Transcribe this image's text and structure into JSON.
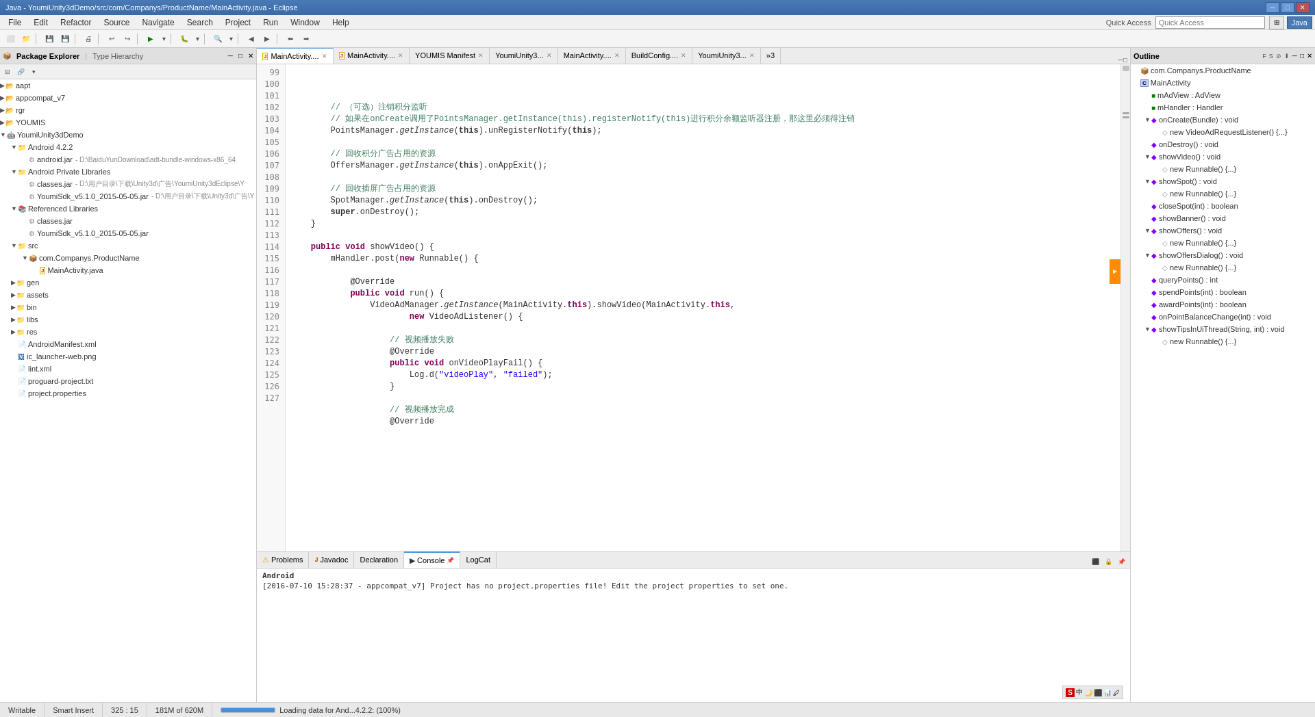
{
  "titleBar": {
    "text": "Java - YoumiUnity3dDemo/src/com/Companys/ProductName/MainActivity.java - Eclipse",
    "minBtn": "─",
    "maxBtn": "□",
    "closeBtn": "✕"
  },
  "menuBar": {
    "items": [
      "File",
      "Edit",
      "Refactor",
      "Source",
      "Navigate",
      "Search",
      "Project",
      "Run",
      "Window",
      "Help"
    ]
  },
  "quickAccess": {
    "label": "Quick Access",
    "placeholder": "Quick Access"
  },
  "packageExplorer": {
    "title": "Package Explorer",
    "typeHierarchy": "Type Hierarchy"
  },
  "editorTabs": [
    {
      "label": "MainActivity....",
      "active": true,
      "icon": "J"
    },
    {
      "label": "MainActivity....",
      "active": false,
      "icon": "J"
    },
    {
      "label": "YOUMIS Manifest",
      "active": false
    },
    {
      "label": "YoumiUnity3...",
      "active": false
    },
    {
      "label": "MainActivity....",
      "active": false
    },
    {
      "label": "BuildConfig....",
      "active": false
    },
    {
      "label": "YoumiUnity3...",
      "active": false
    },
    {
      "label": "»3",
      "active": false
    }
  ],
  "codeLines": [
    {
      "num": "99",
      "content": ""
    },
    {
      "num": "100",
      "content": "        // （可选）注销积分监听"
    },
    {
      "num": "101",
      "content": "        // 如果在onCreate调用了PointsManager.getInstance(this).registerNotify(this)进行积分余额监听器注册，那这里必须得注销"
    },
    {
      "num": "102",
      "content": "        PointsManager.getInstance(this).unRegisterNotify(this);"
    },
    {
      "num": "103",
      "content": ""
    },
    {
      "num": "104",
      "content": "        // 回收积分广告占用的资源"
    },
    {
      "num": "105",
      "content": "        OffersManager.getInstance(this).onAppExit();"
    },
    {
      "num": "106",
      "content": ""
    },
    {
      "num": "107",
      "content": "        // 回收插屏广告占用的资源"
    },
    {
      "num": "108",
      "content": "        SpotManager.getInstance(this).onDestroy();"
    },
    {
      "num": "109",
      "content": "        super.onDestroy();"
    },
    {
      "num": "110",
      "content": "    }"
    },
    {
      "num": "111",
      "content": ""
    },
    {
      "num": "112",
      "content": "    public void showVideo() {",
      "hasArrow": true
    },
    {
      "num": "113",
      "content": "        mHandler.post(new Runnable() {",
      "hasArrow": true
    },
    {
      "num": "114",
      "content": ""
    },
    {
      "num": "115",
      "content": "            @Override",
      "hasArrow": true
    },
    {
      "num": "116",
      "content": "            public void run() {",
      "hasArrow": true
    },
    {
      "num": "117",
      "content": "                VideoAdManager.getInstance(MainActivity.this).showVideo(MainActivity.this,"
    },
    {
      "num": "118",
      "content": "                        new VideoAdListener() {",
      "hasArrow": true
    },
    {
      "num": "119",
      "content": ""
    },
    {
      "num": "120",
      "content": "                    // 视频播放失败"
    },
    {
      "num": "121",
      "content": "                    @Override",
      "hasArrow": true
    },
    {
      "num": "122",
      "content": "                    public void onVideoPlayFail() {",
      "hasArrow": true
    },
    {
      "num": "123",
      "content": "                        Log.d(\"videoPlay\", \"failed\");"
    },
    {
      "num": "124",
      "content": "                    }"
    },
    {
      "num": "125",
      "content": ""
    },
    {
      "num": "126",
      "content": "                    // 视频播放完成"
    },
    {
      "num": "127",
      "content": "                    @Override"
    }
  ],
  "outline": {
    "title": "Outline",
    "items": [
      {
        "indent": 0,
        "type": "package",
        "label": "com.Companys.ProductName"
      },
      {
        "indent": 0,
        "type": "class",
        "label": "MainActivity"
      },
      {
        "indent": 1,
        "type": "field",
        "label": "mAdView : AdView"
      },
      {
        "indent": 1,
        "type": "field",
        "label": "mHandler : Handler"
      },
      {
        "indent": 1,
        "type": "method",
        "label": "onCreate(Bundle) : void",
        "expanded": true
      },
      {
        "indent": 2,
        "type": "inner",
        "label": "new VideoAdRequestListener() {...}"
      },
      {
        "indent": 1,
        "type": "method",
        "label": "onDestroy() : void"
      },
      {
        "indent": 1,
        "type": "method",
        "label": "showVideo() : void",
        "expanded": true
      },
      {
        "indent": 2,
        "type": "inner",
        "label": "new Runnable() {...}"
      },
      {
        "indent": 1,
        "type": "method",
        "label": "showSpot() : void",
        "expanded": true
      },
      {
        "indent": 2,
        "type": "inner",
        "label": "new Runnable() {...}"
      },
      {
        "indent": 1,
        "type": "method",
        "label": "closeSpot(int) : boolean"
      },
      {
        "indent": 1,
        "type": "method",
        "label": "showBanner() : void"
      },
      {
        "indent": 1,
        "type": "method",
        "label": "showOffers() : void",
        "expanded": true
      },
      {
        "indent": 2,
        "type": "inner",
        "label": "new Runnable() {...}"
      },
      {
        "indent": 1,
        "type": "method",
        "label": "showOffersDialog() : void",
        "expanded": true
      },
      {
        "indent": 2,
        "type": "inner",
        "label": "new Runnable() {...}"
      },
      {
        "indent": 1,
        "type": "method",
        "label": "queryPoints() : int"
      },
      {
        "indent": 1,
        "type": "method",
        "label": "spendPoints(int) : boolean"
      },
      {
        "indent": 1,
        "type": "method",
        "label": "awardPoints(int) : boolean"
      },
      {
        "indent": 1,
        "type": "method",
        "label": "onPointBalanceChange(int) : void"
      },
      {
        "indent": 1,
        "type": "method",
        "label": "showTipsInUiThread(String, int) : void",
        "expanded": true
      },
      {
        "indent": 2,
        "type": "inner",
        "label": "new Runnable() {...}"
      }
    ]
  },
  "treeItems": [
    {
      "indent": 0,
      "type": "proj",
      "label": "aapt",
      "expanded": false
    },
    {
      "indent": 0,
      "type": "proj",
      "label": "appcompat_v7",
      "expanded": false
    },
    {
      "indent": 0,
      "type": "proj",
      "label": "rgr",
      "expanded": false
    },
    {
      "indent": 0,
      "type": "proj",
      "label": "YOUMIS",
      "expanded": false
    },
    {
      "indent": 0,
      "type": "android-proj",
      "label": "YoumiUnity3dDemo",
      "expanded": true
    },
    {
      "indent": 1,
      "type": "folder",
      "label": "Android 4.2.2",
      "expanded": true
    },
    {
      "indent": 2,
      "type": "jar",
      "label": "android.jar",
      "detail": "D:\\BaiduYunDownload\\adt-bundle-windows-x86_64"
    },
    {
      "indent": 1,
      "type": "folder",
      "label": "Android Private Libraries",
      "expanded": true
    },
    {
      "indent": 2,
      "type": "jar",
      "label": "classes.jar",
      "detail": "D:\\用户目录\\下载\\Unity3d\\广告\\YoumiUnity3dEclipse\\Y"
    },
    {
      "indent": 2,
      "type": "jar",
      "label": "YoumiSdk_v5.1.0_2015-05-05.jar",
      "detail": "D:\\用户目录\\下载\\Unity3d\\广告\\Y"
    },
    {
      "indent": 1,
      "type": "ref-folder",
      "label": "Referenced Libraries",
      "expanded": true
    },
    {
      "indent": 2,
      "type": "jar",
      "label": "classes.jar"
    },
    {
      "indent": 2,
      "type": "jar",
      "label": "YoumiSdk_v5.1.0_2015-05-05.jar"
    },
    {
      "indent": 1,
      "type": "src-folder",
      "label": "src",
      "expanded": true
    },
    {
      "indent": 2,
      "type": "package",
      "label": "com.Companys.ProductName",
      "expanded": true
    },
    {
      "indent": 3,
      "type": "java",
      "label": "MainActivity.java"
    },
    {
      "indent": 1,
      "type": "folder",
      "label": "gen",
      "expanded": false
    },
    {
      "indent": 1,
      "type": "folder",
      "label": "assets",
      "expanded": false
    },
    {
      "indent": 1,
      "type": "folder",
      "label": "bin",
      "expanded": false
    },
    {
      "indent": 1,
      "type": "folder",
      "label": "libs",
      "expanded": false
    },
    {
      "indent": 1,
      "type": "folder",
      "label": "res",
      "expanded": false
    },
    {
      "indent": 1,
      "type": "xml",
      "label": "AndroidManifest.xml"
    },
    {
      "indent": 1,
      "type": "png",
      "label": "ic_launcher-web.png"
    },
    {
      "indent": 1,
      "type": "xml",
      "label": "lint.xml"
    },
    {
      "indent": 1,
      "type": "file",
      "label": "proguard-project.txt"
    },
    {
      "indent": 1,
      "type": "file",
      "label": "project.properties"
    }
  ],
  "bottomTabs": [
    {
      "label": "Problems",
      "icon": "⚠"
    },
    {
      "label": "Javadoc",
      "icon": "J"
    },
    {
      "label": "Declaration",
      "icon": "D"
    },
    {
      "label": "Console",
      "icon": "▶",
      "active": true
    },
    {
      "label": "LogCat",
      "icon": "L"
    }
  ],
  "console": {
    "header": "Android",
    "message": "[2016-07-10 15:28:37 - appcompat_v7] Project has no project.properties file! Edit the project properties to set one."
  },
  "statusBar": {
    "writable": "Writable",
    "insertMode": "Smart Insert",
    "position": "325 : 15",
    "memory": "181M of 620M",
    "loading": "Loading data for And...4.2.2: (100%)"
  }
}
